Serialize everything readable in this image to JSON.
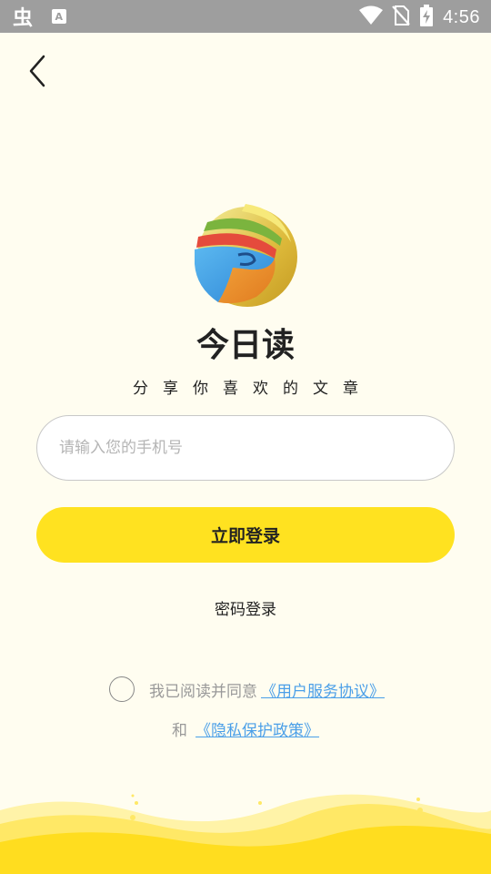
{
  "status_bar": {
    "time": "4:56",
    "left_icons": [
      "bug-icon",
      "keyboard-a-icon"
    ],
    "right_icons": [
      "wifi-icon",
      "no-sim-icon",
      "battery-charging-icon"
    ]
  },
  "header": {
    "back_icon": "chevron-left-icon"
  },
  "app": {
    "name": "今日读",
    "slogan": "分享你喜欢的文章"
  },
  "form": {
    "phone_placeholder": "请输入您的手机号",
    "phone_value": "",
    "login_button": "立即登录",
    "password_login": "密码登录"
  },
  "agreement": {
    "checked": false,
    "prefix": "我已阅读并同意",
    "user_agreement_link": "《用户服务协议》",
    "conjunction": "和",
    "privacy_policy_link": "《隐私保护政策》"
  },
  "colors": {
    "background": "#FFFDF0",
    "primary": "#FFE220",
    "link": "#4A9FE8",
    "status_bar": "#9E9E9E"
  }
}
